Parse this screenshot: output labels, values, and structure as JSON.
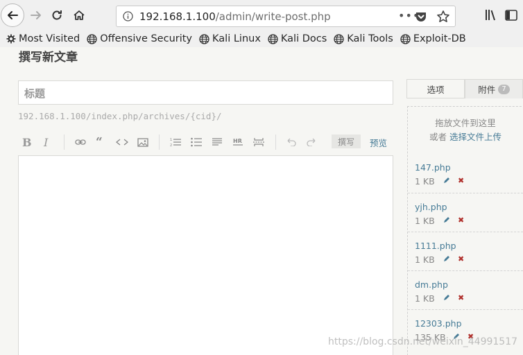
{
  "browser": {
    "url_host": "192.168.1.100",
    "url_path": "/admin/write-post.php",
    "bookmarks": [
      {
        "label": "Most Visited",
        "icon": "gear-icon"
      },
      {
        "label": "Offensive Security",
        "icon": "globe-icon"
      },
      {
        "label": "Kali Linux",
        "icon": "globe-icon"
      },
      {
        "label": "Kali Docs",
        "icon": "globe-icon"
      },
      {
        "label": "Kali Tools",
        "icon": "globe-icon"
      },
      {
        "label": "Exploit-DB",
        "icon": "globe-icon"
      }
    ]
  },
  "page": {
    "title": "撰写新文章",
    "title_placeholder": "标题",
    "permalink": "192.168.1.100/index.php/archives/{cid}/",
    "toolbar": {
      "bold": "B",
      "italic": "I",
      "write_tab": "撰写",
      "preview_tab": "预览"
    }
  },
  "sidebar": {
    "tab_options": "选项",
    "tab_attachments": "附件",
    "attachment_count": "7",
    "drop_line1": "拖放文件到这里",
    "drop_or": "或者",
    "drop_link": "选择文件上传",
    "files": [
      {
        "name": "147.php",
        "size": "1 KB"
      },
      {
        "name": "yjh.php",
        "size": "1 KB"
      },
      {
        "name": "1111.php",
        "size": "1 KB"
      },
      {
        "name": "dm.php",
        "size": "1 KB"
      },
      {
        "name": "12303.php",
        "size": "135 KB"
      }
    ]
  },
  "watermark": "https://blog.csdn.net/weixin_44991517",
  "colors": {
    "link": "#467b96",
    "delete": "#b0302c",
    "background": "#f6f6f3"
  }
}
